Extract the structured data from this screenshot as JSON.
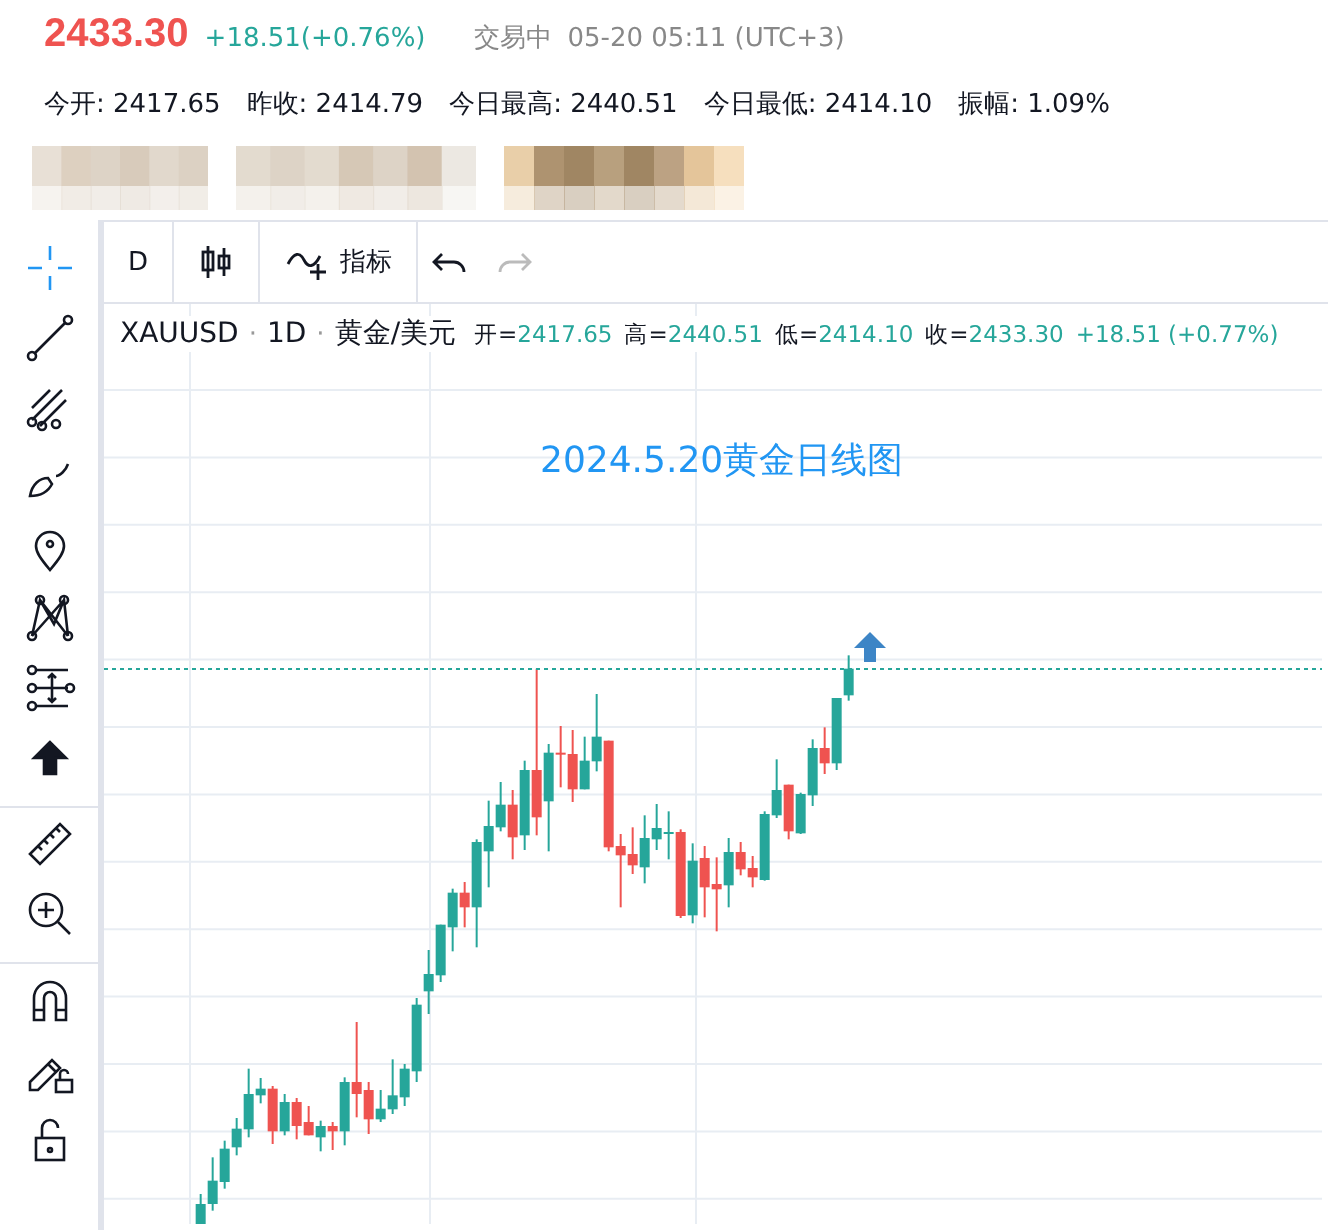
{
  "quote": {
    "price": "2433.30",
    "change": "+18.51(+0.76%)",
    "status": "交易中",
    "time": "05-20 05:11 (UTC+3)"
  },
  "stats": [
    "今开: 2417.65",
    "昨收: 2414.79",
    "今日最高: 2440.51",
    "今日最低: 2414.10",
    "振幅: 1.09%"
  ],
  "tool_groups": [
    [
      {
        "kind": "crosshair",
        "selected": true
      },
      {
        "kind": "trend-line",
        "selected": false
      },
      {
        "kind": "fork",
        "selected": false
      },
      {
        "kind": "brush",
        "selected": false
      },
      {
        "kind": "pin",
        "selected": false
      },
      {
        "kind": "pattern",
        "selected": false
      },
      {
        "kind": "measure",
        "selected": false
      },
      {
        "kind": "arrow",
        "selected": false
      }
    ],
    [
      {
        "kind": "ruler",
        "selected": false
      },
      {
        "kind": "zoom",
        "selected": false
      }
    ],
    [
      {
        "kind": "magnet",
        "selected": false
      },
      {
        "kind": "pencil-lock",
        "selected": false
      },
      {
        "kind": "lock",
        "selected": false
      }
    ]
  ],
  "toolbar": [
    {
      "kind": "interval",
      "label": "D"
    },
    {
      "kind": "candles"
    },
    {
      "kind": "indicators",
      "label": "指标"
    },
    {
      "kind": "undo",
      "disabled": false
    },
    {
      "kind": "redo",
      "disabled": true
    }
  ],
  "legend": {
    "symbol": "XAUUSD",
    "separator_1": "·",
    "interval": "1D",
    "separator_2": "·",
    "name": "黄金/美元",
    "values": [
      {
        "label": "开=",
        "value": "2417.65"
      },
      {
        "label": "高=",
        "value": "2440.51"
      },
      {
        "label": "低=",
        "value": "2414.10"
      },
      {
        "label": "收=",
        "value": "2433.30"
      }
    ],
    "change": "+18.51 (+0.77%)"
  },
  "chart": {
    "title": "2024.5.20黄金日线图"
  }
}
